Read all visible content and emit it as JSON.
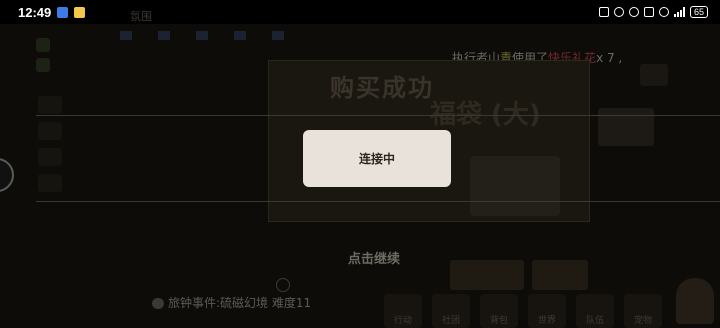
{
  "status_bar": {
    "time": "12:49",
    "battery": "65",
    "icons": [
      "nfc-icon",
      "mute-icon",
      "bluetooth-icon",
      "vibrate-icon",
      "wifi-icon",
      "signal-icon"
    ]
  },
  "game": {
    "chat_prefix": "执行者山",
    "chat_name": "青",
    "chat_mid": "使用了",
    "chat_item": "快乐礼花",
    "chat_suffix": "x 7 ,",
    "popup_title": "购买成功",
    "popup_subtitle": "福袋 (大)",
    "continue_label": "点击继续",
    "event_text": "旅钟事件:硫磁幻境 难度11",
    "left_label": "氛围",
    "bottom_nav": [
      {
        "label": "行动"
      },
      {
        "label": "社团"
      },
      {
        "label": "背包"
      },
      {
        "label": "世界"
      },
      {
        "label": "队伍"
      },
      {
        "label": "宠物"
      }
    ]
  },
  "modal": {
    "message": "连接中"
  }
}
